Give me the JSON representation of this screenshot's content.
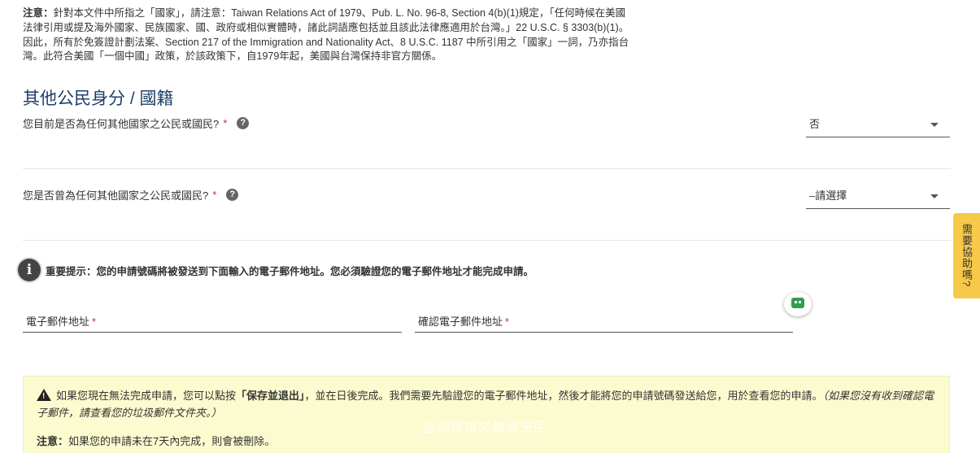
{
  "note_top": {
    "label": "注意：",
    "text": "針對本文件中所指之「國家」，請注意：Taiwan Relations Act of 1979、Pub. L. No. 96-8, Section 4(b)(1)規定，「任何時候在美國法律引用或提及海外國家、民族國家、國、政府或相似實體時，諸此詞語應包括並且該此法律應適用於台灣。」22 U.S.C. § 3303(b)(1)。因此，所有於免簽證計劃法案、Section 217 of the Immigration and Nationality Act、8 U.S.C. 1187 中所引用之「國家」一詞，乃亦指台灣。此符合美國「一個中國」政策，於該政策下，自1979年起，美國與台灣保持非官方關係。"
  },
  "section_title": "其他公民身分 / 國籍",
  "questions": [
    {
      "label": "您目前是否為任何其他國家之公民或國民?",
      "required": "*",
      "help": "?",
      "selected": "否"
    },
    {
      "label": "您是否曾為任何其他國家之公民或國民?",
      "required": "*",
      "help": "?",
      "selected": "–請選擇"
    }
  ],
  "info": {
    "icon": "i",
    "text": "重要提示：您的申請號碼將被發送到下面輸入的電子郵件地址。您必須驗證您的電子郵件地址才能完成申請。"
  },
  "email_fields": {
    "email_label": "電子郵件地址",
    "confirm_label": "確認電子郵件地址",
    "required": "*"
  },
  "help_tab": "需要協助嗎?",
  "warning": {
    "text_before": "如果您現在無法完成申請，您可以點按",
    "bold_action": "「保存並退出」",
    "text_after": "，並在日後完成。我們需要先驗證您的電子郵件地址，然後才能將您的申請號碼發送給您，用於查看您的申請。",
    "italic_note": "（如果您沒有收到確認電子郵件，請查看您的垃圾郵件文件夾。）",
    "note_label": "注意：",
    "note_text": "如果您的申請未在7天內完成，則會被刪除。"
  },
  "watermark": "亞洲排旅文都尚天民",
  "colors": {
    "title": "#1f3f68",
    "required": "#c0392b",
    "help_tab_bg": "#f7c948",
    "warning_bg": "#fbfbcf",
    "chat_icon": "#2e9e4f"
  },
  "icons": {
    "help": "question-circle-icon",
    "info": "info-circle-icon",
    "warning": "warning-triangle-icon",
    "chat": "chat-bot-icon",
    "dropdown": "caret-down-icon"
  }
}
